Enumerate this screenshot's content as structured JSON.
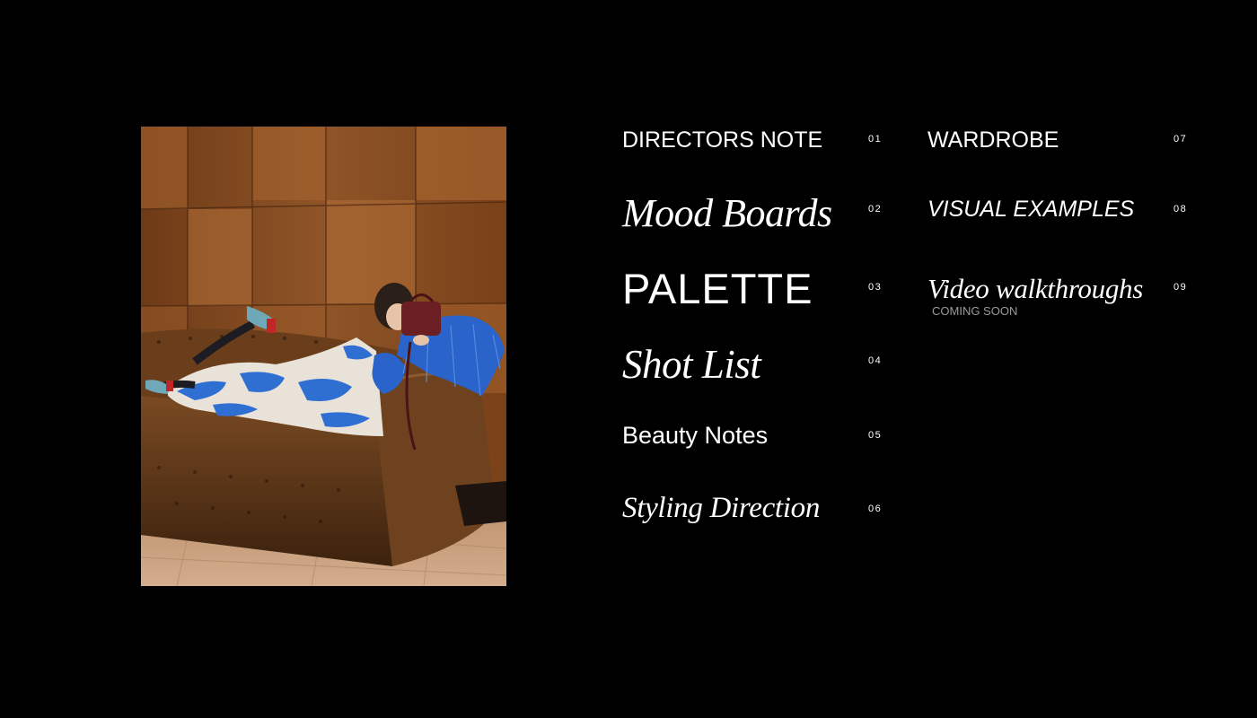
{
  "photo": {
    "alt": "Model in blue and white printed outfit with blue feather trim lounging on a brown leather chesterfield sofa",
    "colors": {
      "wall": "#8a4e22",
      "sofa": "#5a3416",
      "floor": "#c49a78",
      "outfit": "#2f6fd1"
    }
  },
  "menu": {
    "left": [
      {
        "label": "DIRECTORS NOTE",
        "num": "01"
      },
      {
        "label": "Mood Boards",
        "num": "02"
      },
      {
        "label": "PALETTE",
        "num": "03"
      },
      {
        "label": "Shot List",
        "num": "04"
      },
      {
        "label": "Beauty Notes",
        "num": "05"
      },
      {
        "label": "Styling Direction",
        "num": "06"
      }
    ],
    "right": [
      {
        "label": "WARDROBE",
        "num": "07"
      },
      {
        "label": "VISUAL EXAMPLES",
        "num": "08"
      },
      {
        "label": "Video walkthroughs",
        "num": "09",
        "sub": "COMING SOON"
      }
    ]
  }
}
